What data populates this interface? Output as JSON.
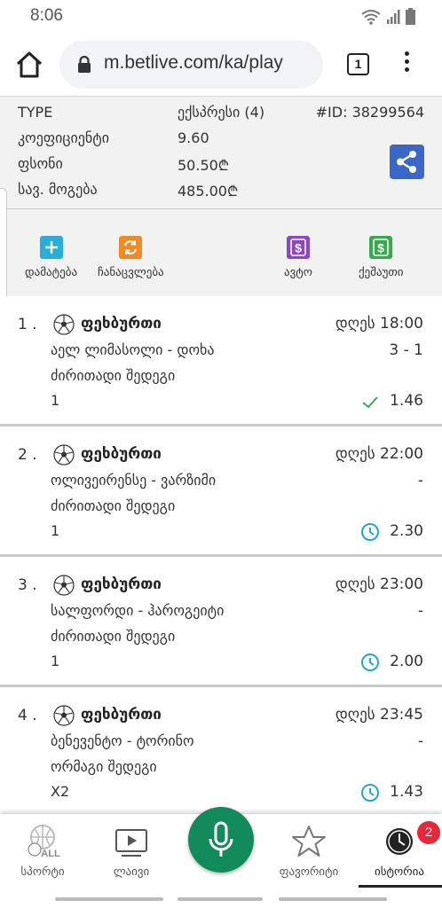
{
  "status_bar": {
    "time": "8:06"
  },
  "browser": {
    "url": "m.betlive.com/ka/play",
    "tab_count": "1"
  },
  "ticket": {
    "type_label": "TYPE",
    "type_value": "ექსპრესი (4)",
    "id": "#ID: 38299564",
    "coef_label": "კოეფიციენტი",
    "coef_value": "9.60",
    "stake_label": "ფსონი",
    "stake_value": "50.50₾",
    "win_label": "სავ. მოგება",
    "win_value": "485.00₾"
  },
  "actions": [
    {
      "label": "დამატება",
      "icon": "plus-icon",
      "color": "#2aaed8"
    },
    {
      "label": "ჩანაცვლება",
      "icon": "swap-icon",
      "color": "#f08a24"
    },
    {
      "label": "ავტო",
      "icon": "dollar-icon",
      "color": "#8b46c9"
    },
    {
      "label": "ქეშაუთი",
      "icon": "dollar-icon",
      "color": "#3aa84f"
    }
  ],
  "bets": [
    {
      "num": "1 .",
      "sport": "ფეხბურთი",
      "time": "დღეს 18:00",
      "match": "აელ ლიმასოლი - დოხა",
      "score": "3 - 1",
      "market": "ძირითადი შედეგი",
      "pick": "1",
      "status": "won",
      "odds": "1.46"
    },
    {
      "num": "2 .",
      "sport": "ფეხბურთი",
      "time": "დღეს 22:00",
      "match": "ოლივეირენსე - ვარზიმი",
      "score": "-",
      "market": "ძირითადი შედეგი",
      "pick": "1",
      "status": "pending",
      "odds": "2.30"
    },
    {
      "num": "3 .",
      "sport": "ფეხბურთი",
      "time": "დღეს 23:00",
      "match": "სალფორდი - ჰაროგეიტი",
      "score": "-",
      "market": "ძირითადი შედეგი",
      "pick": "1",
      "status": "pending",
      "odds": "2.00"
    },
    {
      "num": "4 .",
      "sport": "ფეხბურთი",
      "time": "დღეს 23:45",
      "match": "ბენევენტო - ტორინო",
      "score": "-",
      "market": "ორმაგი შედეგი",
      "pick": "X2",
      "status": "pending",
      "odds": "1.43"
    }
  ],
  "nav": {
    "sports": "სპორტი",
    "sports_icon_text": "ALL",
    "live": "ლაივი",
    "favorites": "ფავორიტი",
    "history": "ისტორია",
    "history_badge": "2"
  },
  "colors": {
    "share": "#3b67c9",
    "mic": "#138a5b",
    "won": "#3aa84f",
    "pending": "#1fa8d6",
    "badge": "#e8273b"
  }
}
